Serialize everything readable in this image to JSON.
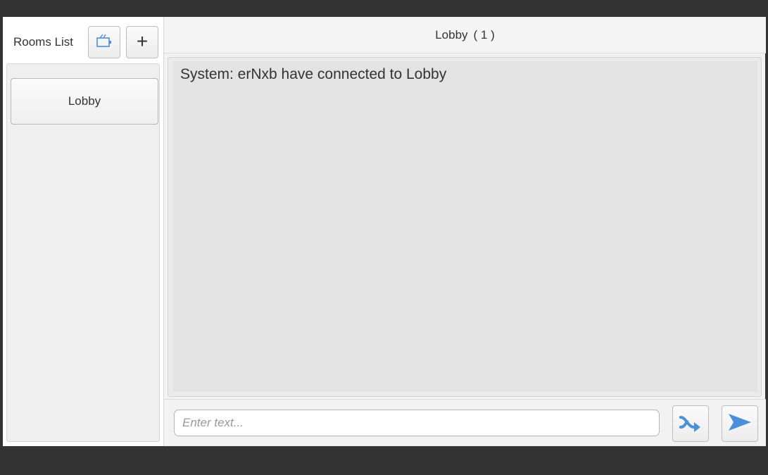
{
  "sidebar": {
    "title": "Rooms List",
    "buttons": [
      {
        "icon": "room-list-icon"
      },
      {
        "icon": "plus-icon",
        "label": "+"
      }
    ],
    "rooms": [
      {
        "label": "Lobby"
      }
    ]
  },
  "room_header": {
    "name": "Lobby",
    "count": "( 1 )"
  },
  "chat": {
    "messages": [
      {
        "text": "System: erNxb have connected to Lobby"
      }
    ]
  },
  "composer": {
    "placeholder": "Enter text...",
    "value": "",
    "shuffle_icon": "shuffle-icon",
    "send_icon": "send-icon"
  },
  "colors": {
    "accent": "#4a90d9",
    "window_frame": "#333333",
    "panel": "#efefef"
  }
}
